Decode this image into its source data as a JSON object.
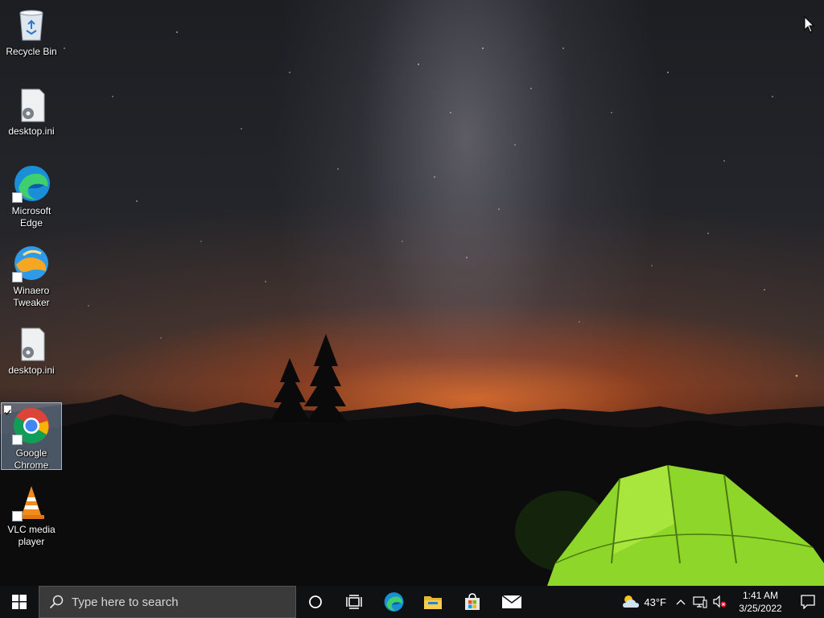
{
  "desktop": {
    "icons": [
      {
        "label": "Recycle Bin",
        "icon": "recycle-bin-icon"
      },
      {
        "label": "desktop.ini",
        "icon": "settings-file-icon"
      },
      {
        "label": "Microsoft Edge",
        "icon": "edge-icon"
      },
      {
        "label": "Winaero Tweaker",
        "icon": "winaero-tweaker-icon"
      },
      {
        "label": "desktop.ini",
        "icon": "settings-file-icon"
      },
      {
        "label": "Google Chrome",
        "icon": "chrome-icon",
        "selected": true
      },
      {
        "label": "VLC media player",
        "icon": "vlc-icon"
      }
    ]
  },
  "taskbar": {
    "search": {
      "placeholder": "Type here to search"
    },
    "pinned": [
      {
        "name": "Microsoft Edge",
        "icon": "edge-icon"
      },
      {
        "name": "File Explorer",
        "icon": "folder-icon"
      },
      {
        "name": "Microsoft Store",
        "icon": "store-icon"
      },
      {
        "name": "Mail",
        "icon": "mail-icon"
      }
    ],
    "weather": {
      "temperature": "43°F",
      "icon": "partly-cloudy-icon"
    },
    "clock": {
      "time": "1:41 AM",
      "date": "3/25/2022"
    }
  },
  "colors": {
    "taskbar_bg": "#101113",
    "search_bg": "#3a3a3a",
    "selection_bg": "#a0bee1",
    "tent_green": "#8fd62a"
  }
}
